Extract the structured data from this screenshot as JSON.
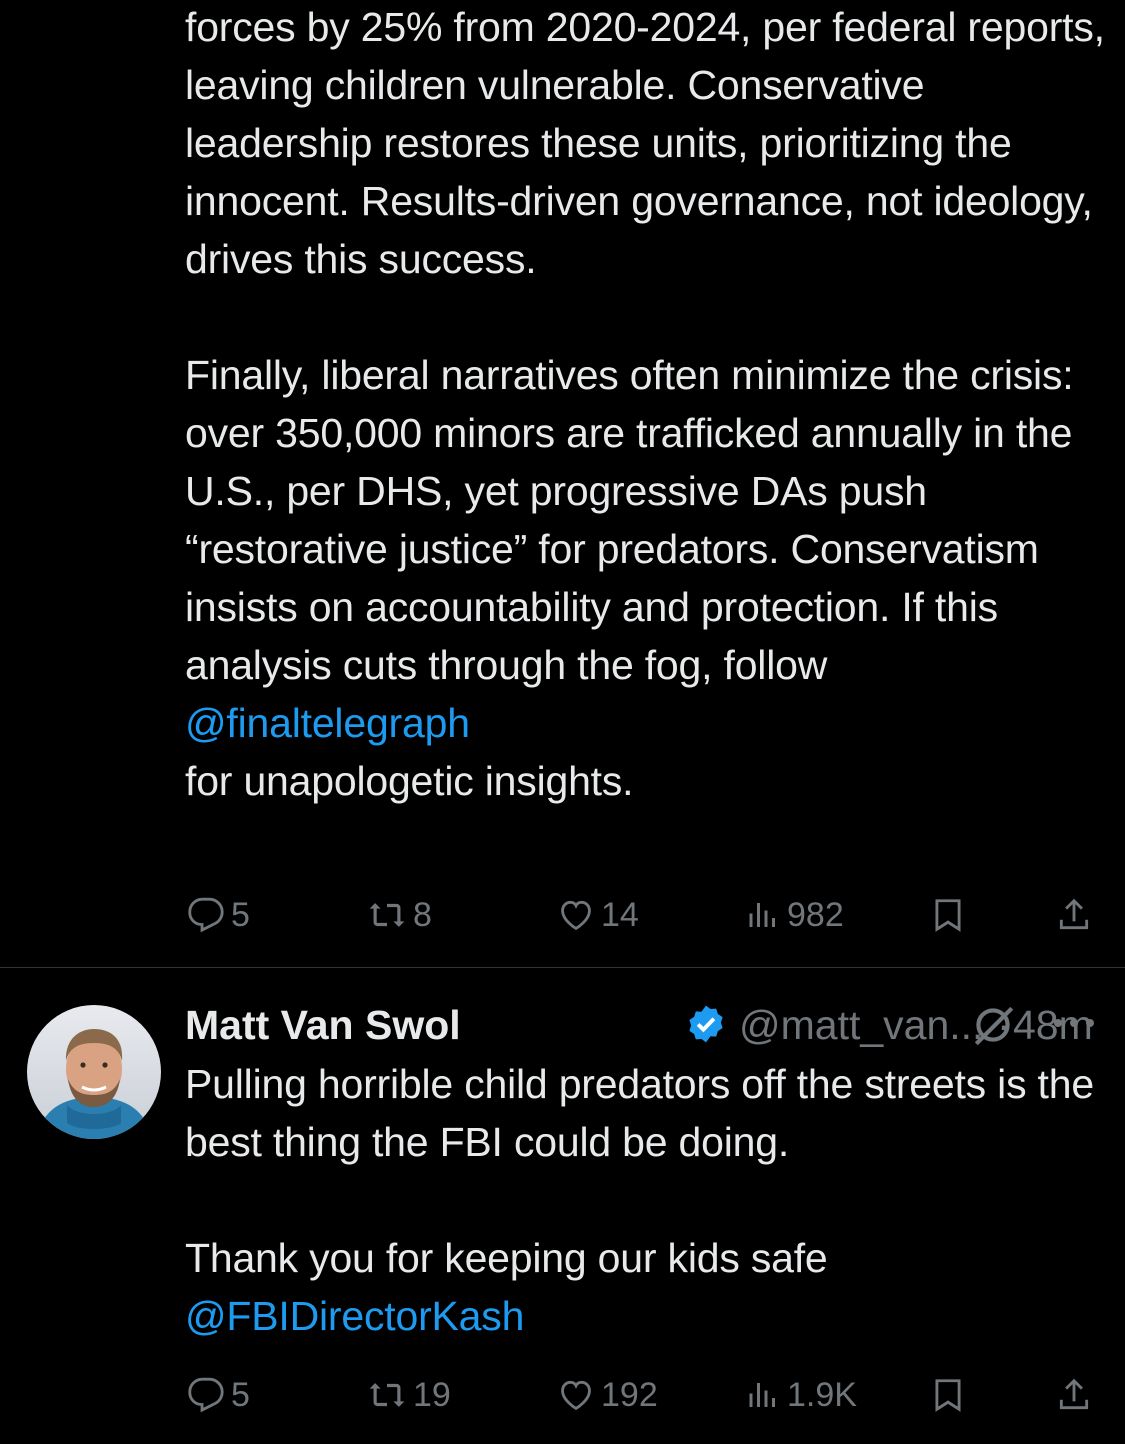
{
  "tweets": [
    {
      "paragraphs": [
        {
          "text": "forces by 25% from 2020-2024, per federal reports, leaving children vulnerable. Conservative leadership restores these units, prioritizing the innocent. Results-driven governance, not ideology, drives this success."
        },
        {
          "text": "Finally, liberal narratives often minimize the crisis: over 350,000 minors are trafficked annually in the U.S., per DHS, yet progressive DAs push “restorative justice” for predators. Conservatism insists on accountability and protection. If this analysis cuts through the fog, follow ",
          "mention": "@finaltelegraph",
          "after_mention": " for unapologetic insights."
        }
      ],
      "stats": {
        "replies": "5",
        "reposts": "8",
        "likes": "14",
        "views": "982"
      }
    },
    {
      "author": {
        "name": "Matt Van Swol",
        "handle": "@matt_van...",
        "separator": "·",
        "time": "48m"
      },
      "paragraphs": [
        {
          "text": "Pulling horrible child predators off the streets is the best thing the FBI could be doing."
        },
        {
          "text": "Thank you for keeping our kids safe",
          "mention": "@FBIDirectorKash"
        }
      ],
      "stats": {
        "replies": "5",
        "reposts": "19",
        "likes": "192",
        "views": "1.9K"
      }
    }
  ],
  "icons": {
    "reply": "reply-icon",
    "repost": "repost-icon",
    "like": "heart-icon",
    "views": "views-icon",
    "bookmark": "bookmark-icon",
    "share": "share-icon",
    "verified": "verified-badge-icon",
    "grok": "grok-icon",
    "more": "more-dots-icon"
  },
  "colors": {
    "background": "#000000",
    "text": "#e7e9ea",
    "secondary": "#71767b",
    "link": "#1d9bf0",
    "divider": "#2f3336"
  }
}
